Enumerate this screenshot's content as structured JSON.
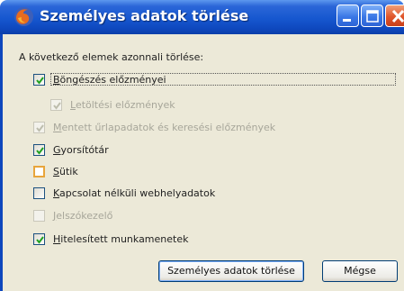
{
  "window": {
    "title": "Személyes adatok törlése",
    "controls": {
      "minimize": "minimize",
      "maximize": "maximize",
      "close": "close"
    }
  },
  "intro_text": "A következő elemek azonnali törlése:",
  "items": [
    {
      "label": "Böngészés előzményei",
      "checked": true,
      "disabled": false
    },
    {
      "label": "Letöltési előzmények",
      "checked": true,
      "disabled": true
    },
    {
      "label": "Mentett űrlapadatok és keresési előzmények",
      "checked": true,
      "disabled": true
    },
    {
      "label": "Gyorsítótár",
      "checked": true,
      "disabled": false
    },
    {
      "label": "Sütik",
      "checked": false,
      "disabled": false,
      "highlighted": true
    },
    {
      "label": "Kapcsolat nélküli webhelyadatok",
      "checked": false,
      "disabled": false
    },
    {
      "label": "Jelszókezelő",
      "checked": false,
      "disabled": true
    },
    {
      "label": "Hitelesített munkamenetek",
      "checked": true,
      "disabled": false
    }
  ],
  "buttons": {
    "clear": "Személyes adatok törlése",
    "cancel": "Mégse"
  },
  "colors": {
    "titlebar": "#1657cf",
    "dialog_bg": "#ece9d8",
    "checkbox_border": "#1c5180",
    "checkmark": "#21a121",
    "disabled_text": "#a7a69a",
    "highlight": "#e8a53b"
  },
  "icons": {
    "app": "firefox-icon",
    "check": "check-icon"
  }
}
